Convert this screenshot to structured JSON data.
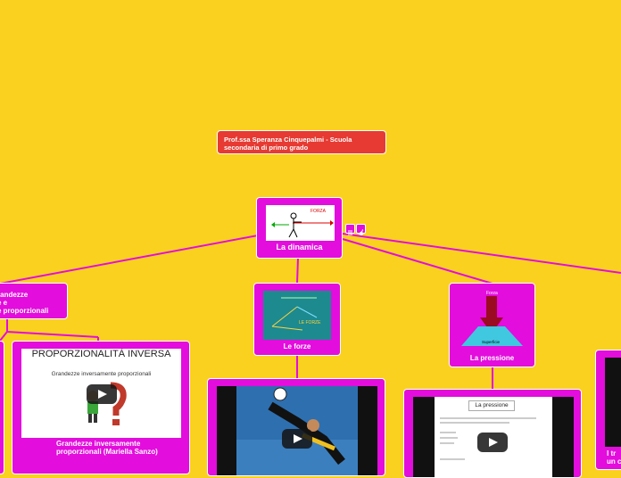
{
  "colors": {
    "background": "#f9d11e",
    "node": "#e30ddd",
    "title": "#e63a32",
    "link": "#e30ddd"
  },
  "title_node": {
    "text": "Prof.ssa Speranza Cinquepalmi  - Scuola secondaria di primo grado"
  },
  "central": {
    "label": "La dinamica",
    "image_text": "FORZA",
    "icons": [
      "notes-icon",
      "attachment-icon"
    ]
  },
  "nodes": {
    "grandezze": {
      "lines": [
        "randezze",
        "e e",
        "e proporzionali"
      ]
    },
    "forze": {
      "label": "Le forze",
      "image_text": "LE FORZE"
    },
    "pressione": {
      "label": "La pressione",
      "image_text_top": "Forza",
      "image_text_bottom": "Superficie"
    },
    "proporzionalita": {
      "image_title": "PROPORZIONALITÀ INVERSA",
      "image_subtitle": "Grandezze inversamente proporzionali",
      "label": "Grandezze inversamente proporzionali (Mariella Sanzo)"
    },
    "forze_video": {},
    "pressione_video": {
      "doc_title": "La pressione"
    },
    "right_node": {
      "label_line1": "I tr",
      "label_line2": "un c"
    }
  }
}
